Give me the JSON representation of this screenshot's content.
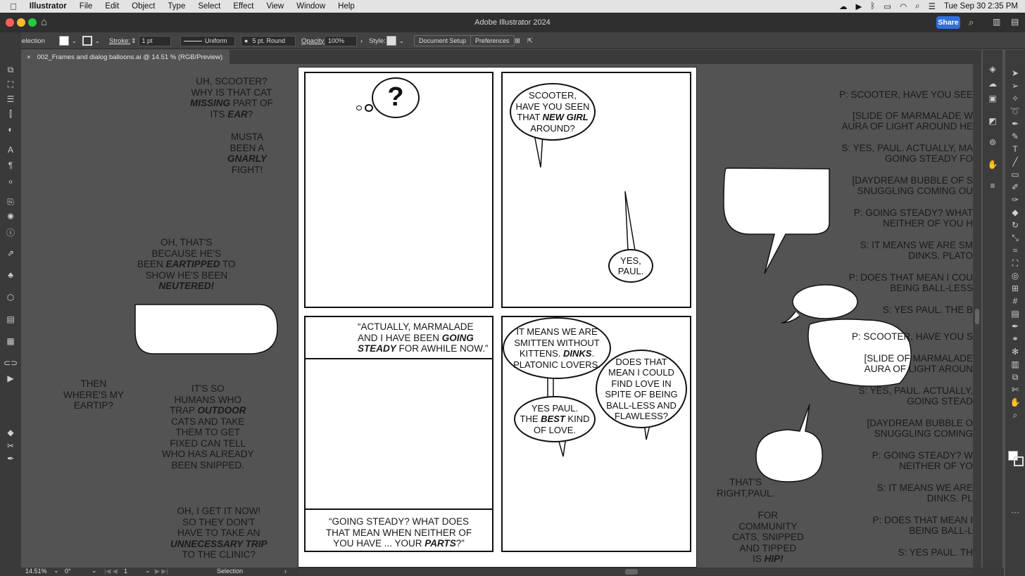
{
  "menubar": {
    "app": "Illustrator",
    "items": [
      "File",
      "Edit",
      "Object",
      "Type",
      "Select",
      "Effect",
      "View",
      "Window",
      "Help"
    ],
    "clock": "Tue Sep 30  2:35 PM"
  },
  "window": {
    "title": "Adobe Illustrator 2024",
    "share": "Share"
  },
  "control": {
    "selection": "No Selection",
    "stroke_label": "Stroke:",
    "stroke_value": "1 pt",
    "profile": "Uniform",
    "brush": "5 pt. Round",
    "opacity_label": "Opacity:",
    "opacity_value": "100%",
    "style_label": "Style:",
    "doc_setup": "Document Setup",
    "preferences": "Preferences"
  },
  "tab": {
    "title": "002_Frames and dialog balloons.ai @ 14.51 % (RGB/Preview)",
    "close": "×"
  },
  "status": {
    "zoom": "14.51%",
    "rotation": "0°",
    "artboard": "1",
    "tool": "Selection"
  },
  "left_texts": [
    {
      "key": "t1",
      "lines": [
        "UH, SCOOTER?",
        "WHY IS THAT CAT",
        "<em>MISSING</em> PART OF",
        "ITS <em>EAR</em>?"
      ]
    },
    {
      "key": "t2",
      "lines": [
        "MUSTA",
        "BEEN A",
        "<em>GNARLY</em>",
        "FIGHT!"
      ]
    },
    {
      "key": "t3",
      "lines": [
        "OH, THAT'S",
        "BECAUSE HE'S",
        "BEEN <em>EARTIPPED</em> TO",
        "SHOW HE'S BEEN",
        "<em>NEUTERED!</em>"
      ]
    },
    {
      "key": "t4",
      "lines": [
        "THEN",
        "WHERE'S MY",
        "EARTIP?"
      ]
    },
    {
      "key": "t5",
      "lines": [
        "IT'S SO",
        "HUMANS WHO",
        "TRAP <em>OUTDOOR</em>",
        "CATS AND TAKE",
        "THEM TO GET",
        "FIXED CAN TELL",
        "WHO HAS ALREADY",
        "BEEN SNIPPED."
      ]
    },
    {
      "key": "t6",
      "lines": [
        "OH, I GET IT NOW!",
        "SO THEY DON'T",
        "HAVE TO TAKE AN",
        "<em>UNNECESSARY TRIP</em>",
        "TO THE CLINIC?"
      ]
    }
  ],
  "right_texts": [
    {
      "key": "r1",
      "lines": [
        "THAT'S",
        "RIGHT,PAUL."
      ]
    },
    {
      "key": "r2",
      "lines": [
        "FOR",
        "COMMUNITY",
        "CATS, SNIPPED",
        "AND TIPPED",
        "IS <em>HIP!</em>"
      ]
    }
  ],
  "script_lines": [
    "P: SCOOTER, HAVE YOU SEE",
    "[SLIDE OF MARMALADE W",
    "AURA OF LIGHT AROUND HE",
    "S: YES, PAUL. ACTUALLY, MA",
    "GOING STEADY FO",
    "[DAYDREAM BUBBLE OF S",
    "SNUGGLING COMING OU",
    "P: GOING STEADY? WHAT",
    "NEITHER OF YOU H",
    "S: IT MEANS WE ARE SM",
    "DINKS. PLATO",
    "P: DOES THAT MEAN I COU",
    "BEING BALL-LESS",
    "S: YES PAUL. THE B",
    "P: SCOOTER, HAVE YOU S",
    "[SLIDE OF MARMALADE",
    "AURA OF LIGHT AROUN",
    "S: YES, PAUL. ACTUALLY,",
    "GOING STEAD",
    "[DAYDREAM BUBBLE O",
    "SNUGGLING COMING",
    "P: GOING STEADY? W",
    "NEITHER OF YO",
    "S: IT MEANS WE ARE",
    "DINKS. PL",
    "P: DOES THAT MEAN I",
    "BEING BALL-L",
    "S: YES PAUL. TH"
  ],
  "comic": {
    "thought": "?",
    "b1": [
      "SCOOTER,",
      "HAVE YOU SEEN",
      "THAT <em>NEW GIRL</em>",
      "AROUND?"
    ],
    "b2": [
      "YES,",
      "PAUL."
    ],
    "cap1": [
      "“ACTUALLY, MARMALADE",
      "AND I HAVE BEEN <em>GOING</em>",
      "<em>STEADY</em> FOR AWHILE NOW.”"
    ],
    "cap2": [
      "“GOING STEADY? WHAT DOES",
      "THAT MEAN WHEN NEITHER OF",
      "YOU HAVE ... YOUR <em>PARTS</em>?”"
    ],
    "b3": [
      "IT MEANS WE ARE",
      "SMITTEN WITHOUT",
      "KITTENS. <em>DINKS</em>.",
      "PLATONIC LOVERS."
    ],
    "b4": [
      "DOES THAT",
      "MEAN I COULD",
      "FIND LOVE IN",
      "SPITE OF BEING",
      "BALL-LESS AND",
      "FLAWLESS?"
    ],
    "b5": [
      "YES PAUL.",
      "THE <em>BEST</em> KIND",
      "OF LOVE."
    ]
  }
}
